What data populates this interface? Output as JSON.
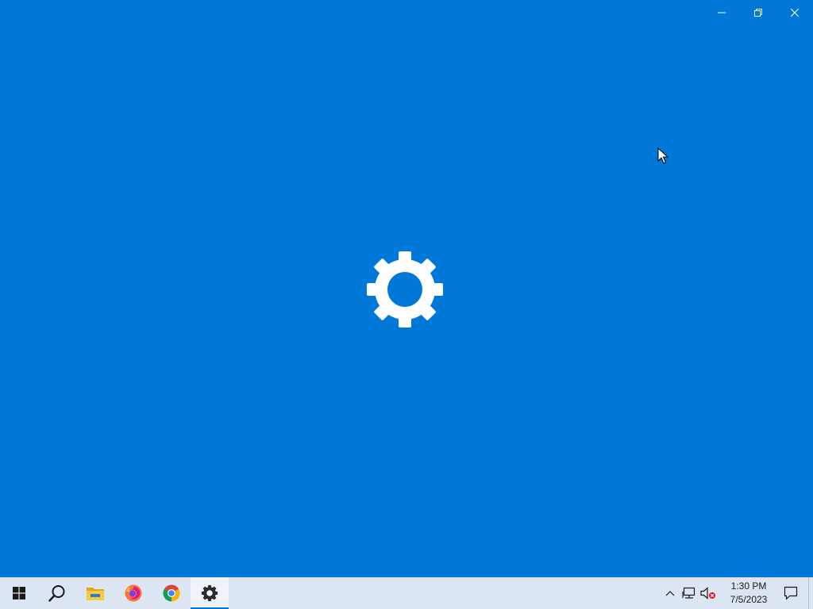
{
  "window": {
    "app": "Settings",
    "background_color": "#0078d7",
    "splash_icon": "gear-icon",
    "caption_buttons": [
      "minimize-icon",
      "restore-icon",
      "close-icon"
    ]
  },
  "taskbar": {
    "background_color": "#dce6f2",
    "accent_color": "#0078d7",
    "items": [
      {
        "name": "start",
        "icon": "windows-logo-icon",
        "active": false
      },
      {
        "name": "search",
        "icon": "search-icon",
        "active": false
      },
      {
        "name": "file-explorer",
        "icon": "folder-icon",
        "active": false
      },
      {
        "name": "firefox",
        "icon": "firefox-icon",
        "active": false
      },
      {
        "name": "chrome",
        "icon": "chrome-icon",
        "active": false
      },
      {
        "name": "settings",
        "icon": "gear-icon",
        "active": true
      }
    ],
    "tray": {
      "icons": [
        "chevron-up-icon",
        "network-icon",
        "volume-muted-icon"
      ],
      "clock": {
        "time": "1:30 PM",
        "date": "7/5/2023"
      },
      "notification_icon": "action-center-icon"
    }
  }
}
